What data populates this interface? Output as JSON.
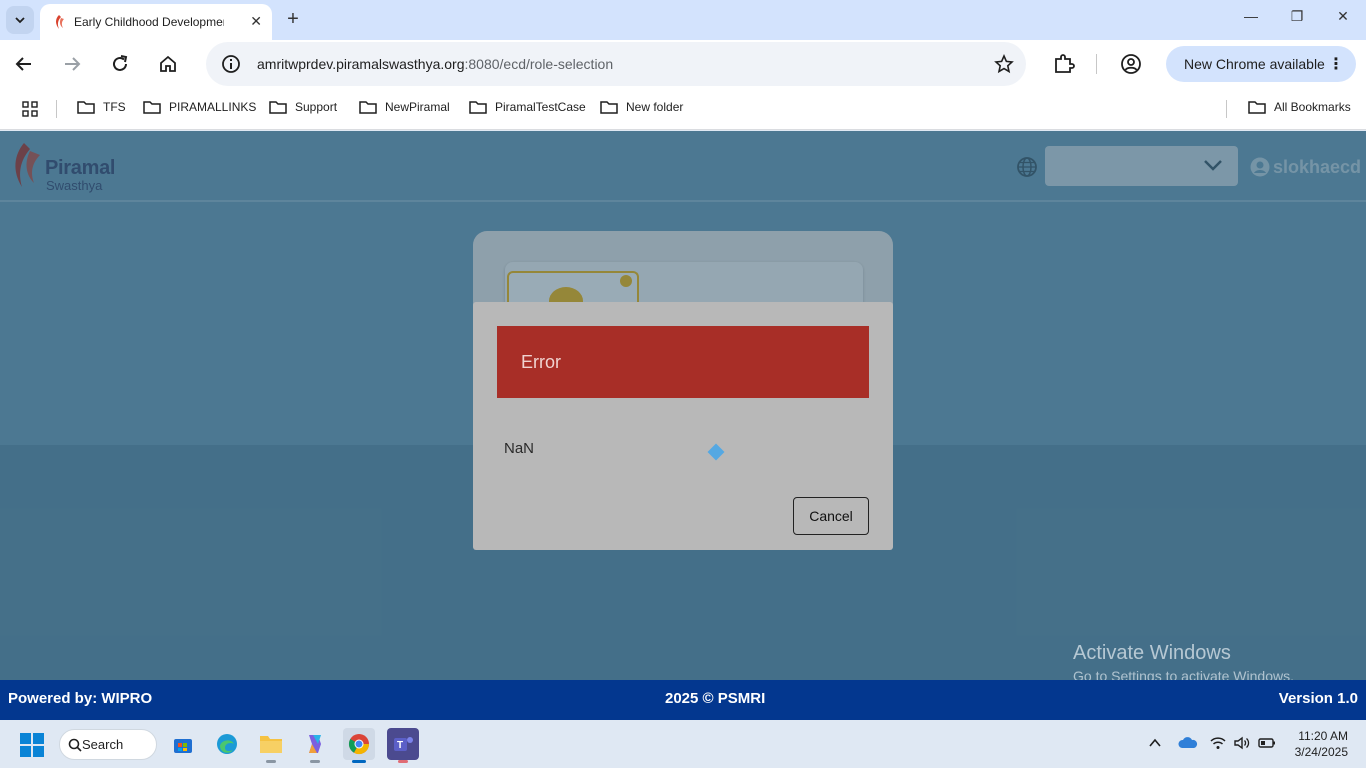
{
  "browser": {
    "tab_title": "Early Childhood Development",
    "url_host": "amritwprdev.piramalswasthya.org",
    "url_path": ":8080/ecd/role-selection",
    "update_label": "New Chrome available",
    "bookmarks": [
      "TFS",
      "PIRAMALLINKS",
      "Support",
      "NewPiramal",
      "PiramalTestCase",
      "New folder"
    ],
    "all_bookmarks_label": "All Bookmarks"
  },
  "app": {
    "logo_name": "Piramal",
    "logo_sub": "Swasthya",
    "username": "slokhaecd",
    "language_value": ""
  },
  "dialog": {
    "title": "Error",
    "message": "NaN",
    "cancel_label": "Cancel"
  },
  "watermark": {
    "title": "Activate Windows",
    "subtitle": "Go to Settings to activate Windows."
  },
  "footer": {
    "left": "Powered by: WIPRO",
    "center": "2025 © PSMRI",
    "right": "Version 1.0"
  },
  "taskbar": {
    "search_label": "Search",
    "time": "11:20 AM",
    "date": "3/24/2025"
  },
  "colors": {
    "error_header": "#a82e27",
    "footer_bg": "#03378f",
    "app_bg": "#6d9db8"
  }
}
